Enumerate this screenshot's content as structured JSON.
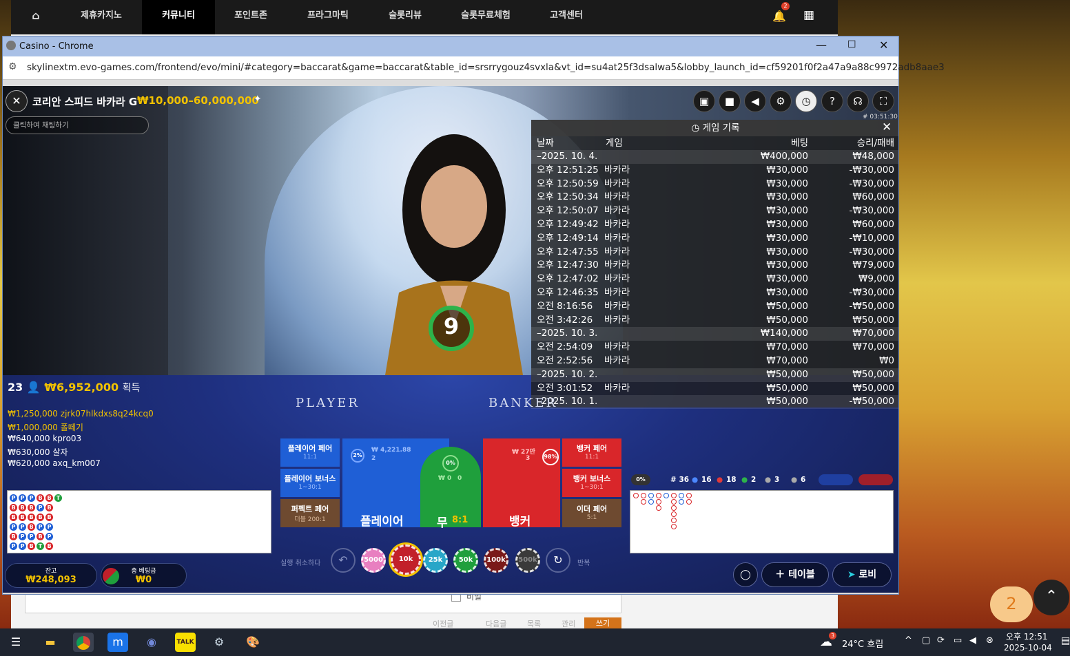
{
  "site": {
    "nav": [
      "제휴카지노",
      "커뮤니티",
      "포인트존",
      "프라그마틱",
      "슬롯리뷰",
      "슬롯무료체험",
      "고객센터"
    ],
    "active_nav": "커뮤니티",
    "bell_count": "2",
    "post_bar": {
      "prev": "이전글",
      "next": "다음글",
      "list": "목록",
      "manage": "관리",
      "write": "쓰기",
      "check_label": "비밀"
    },
    "chat_count": "2"
  },
  "window": {
    "title": "Casino - Chrome",
    "url": "skylinextm.evo-games.com/frontend/evo/mini/#category=baccarat&game=baccarat&table_id=srsrrygouz4svxla&vt_id=su4at25f3dsalwa5&lobby_launch_id=cf59201f0f2a47a9a88c9972adb8aae3"
  },
  "game": {
    "table_name": "코리안 스피드 바카라 G",
    "limits": "₩10,000–60,000,000",
    "chat_placeholder": "클릭하여 채팅하기",
    "timer_label": "# 03:51:30",
    "countdown": "9",
    "winners_count": "23",
    "winners_total": "₩6,952,000",
    "winners_suffix": "획득",
    "winners": [
      {
        "amount": "₩1,250,000",
        "name": "zjrk07hlkdxs8q24kcq0"
      },
      {
        "amount": "₩1,000,000",
        "name": "폴떼기"
      },
      {
        "amount": "₩640,000",
        "name": "kpro03"
      },
      {
        "amount": "₩630,000",
        "name": "살자"
      },
      {
        "amount": "₩620,000",
        "name": "axq_km007"
      }
    ],
    "table_words": {
      "player": "PLAYER",
      "banker": "BANKER"
    },
    "bets": {
      "player_pair": "플레이어 페어",
      "player_pair_odds": "11:1",
      "player_bonus": "플레이어 보너스",
      "player_bonus_odds": "1~30:1",
      "perfect_pair": "퍼펙트 페어",
      "perfect_pair_odds": "더블 200:1",
      "player": "플레이어",
      "player_pct": "2%",
      "player_amount": "₩ 4,221.88",
      "player_count": "2",
      "tie": "무",
      "tie_odds": "8:1",
      "tie_pct": "0%",
      "tie_amount": "₩ 0",
      "tie_count": "0",
      "banker": "뱅커",
      "banker_pct": "98%",
      "banker_amount": "₩ 27만",
      "banker_count": "3",
      "banker_pair": "뱅커 페어",
      "banker_pair_odds": "11:1",
      "banker_bonus": "뱅커 보너스",
      "banker_bonus_odds": "1~30:1",
      "either_pair": "이더 페어",
      "either_pair_odds": "5:1"
    },
    "undo_label": "실행 취소하다",
    "repeat_label": "반복",
    "chips": [
      "5000",
      "10k",
      "25k",
      "50k",
      "100k",
      "500k"
    ],
    "balance_label": "잔고",
    "balance": "₩248,093",
    "total_bet_label": "총 베팅금",
    "total_bet": "₩0",
    "stats": {
      "pct": "0%",
      "rounds": "# 36",
      "p": "16",
      "b": "18",
      "t": "2",
      "pp": "3",
      "bp": "6"
    },
    "table_btn": "테이블",
    "lobby_btn": "로비"
  },
  "history": {
    "title": "게임 기록",
    "columns": [
      "날짜",
      "게임",
      "베팅",
      "승리/패배"
    ],
    "rows": [
      {
        "date": "–2025. 10. 4.",
        "game": "",
        "bet": "₩400,000",
        "result": "₩48,000",
        "group": true
      },
      {
        "date": "오후 12:51:25",
        "game": "바카라",
        "bet": "₩30,000",
        "result": "-₩30,000"
      },
      {
        "date": "오후 12:50:59",
        "game": "바카라",
        "bet": "₩30,000",
        "result": "-₩30,000"
      },
      {
        "date": "오후 12:50:34",
        "game": "바카라",
        "bet": "₩30,000",
        "result": "₩60,000"
      },
      {
        "date": "오후 12:50:07",
        "game": "바카라",
        "bet": "₩30,000",
        "result": "-₩30,000"
      },
      {
        "date": "오후 12:49:42",
        "game": "바카라",
        "bet": "₩30,000",
        "result": "₩60,000"
      },
      {
        "date": "오후 12:49:14",
        "game": "바카라",
        "bet": "₩30,000",
        "result": "-₩10,000"
      },
      {
        "date": "오후 12:47:55",
        "game": "바카라",
        "bet": "₩30,000",
        "result": "-₩30,000"
      },
      {
        "date": "오후 12:47:30",
        "game": "바카라",
        "bet": "₩30,000",
        "result": "₩79,000"
      },
      {
        "date": "오후 12:47:02",
        "game": "바카라",
        "bet": "₩30,000",
        "result": "₩9,000"
      },
      {
        "date": "오후 12:46:35",
        "game": "바카라",
        "bet": "₩30,000",
        "result": "-₩30,000"
      },
      {
        "date": "오전 8:16:56",
        "game": "바카라",
        "bet": "₩50,000",
        "result": "-₩50,000"
      },
      {
        "date": "오전 3:42:26",
        "game": "바카라",
        "bet": "₩50,000",
        "result": "₩50,000"
      },
      {
        "date": "–2025. 10. 3.",
        "game": "",
        "bet": "₩140,000",
        "result": "₩70,000",
        "group": true
      },
      {
        "date": "오전 2:54:09",
        "game": "바카라",
        "bet": "₩70,000",
        "result": "₩70,000"
      },
      {
        "date": "오전 2:52:56",
        "game": "바카라",
        "bet": "₩70,000",
        "result": "₩0"
      },
      {
        "date": "–2025. 10. 2.",
        "game": "",
        "bet": "₩50,000",
        "result": "₩50,000",
        "group": true
      },
      {
        "date": "오전 3:01:52",
        "game": "바카라",
        "bet": "₩50,000",
        "result": "₩50,000"
      },
      {
        "date": "–2025. 10. 1.",
        "game": "",
        "bet": "₩50,000",
        "result": "-₩50,000",
        "group": true
      }
    ]
  },
  "bead_road": [
    [
      "P",
      "P",
      "P",
      "B",
      "B",
      "T"
    ],
    [
      "B",
      "B",
      "B",
      "P",
      "B",
      ""
    ],
    [
      "B",
      "B",
      "B",
      "B",
      "B",
      ""
    ],
    [
      "P",
      "P",
      "B",
      "P",
      "P",
      ""
    ],
    [
      "B",
      "P",
      "P",
      "B",
      "P",
      ""
    ],
    [
      "P",
      "P",
      "B",
      "T",
      "B",
      ""
    ]
  ],
  "taskbar": {
    "weather": "24°C 흐림",
    "weather_badge": "3",
    "time": "오후 12:51",
    "date": "2025-10-04"
  },
  "colors": {
    "accent_gold": "#f2c200",
    "player_blue": "#1f5fd6",
    "banker_red": "#d9262a",
    "tie_green": "#1f9f3c"
  }
}
